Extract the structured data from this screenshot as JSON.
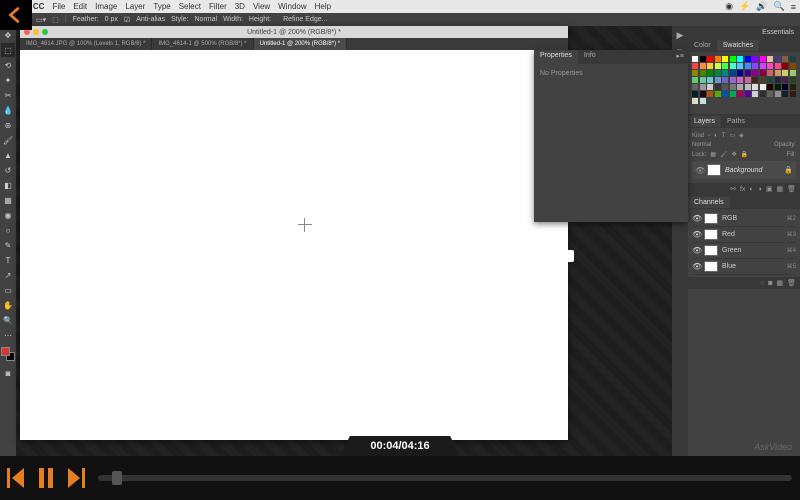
{
  "mac_menu": {
    "app": "toshop CC",
    "items": [
      "File",
      "Edit",
      "Image",
      "Layer",
      "Type",
      "Select",
      "Filter",
      "3D",
      "View",
      "Window",
      "Help"
    ]
  },
  "options": {
    "feather_label": "Feather:",
    "feather_value": "0 px",
    "antialias": "Anti-alias",
    "style_label": "Style:",
    "style_value": "Normal",
    "width_label": "Width:",
    "height_label": "Height:",
    "refine": "Refine Edge..."
  },
  "doc": {
    "title": "Untitled-1 @ 200% (RGB/8*) *",
    "tabs": [
      {
        "label": "IMG_4614.JPG @ 100% (Levels 1, RGB/8) *"
      },
      {
        "label": "IMG_4614-1 @ 500% (RGB/8*) *"
      },
      {
        "label": "Untitled-1 @ 200% (RGB/8*) *"
      }
    ]
  },
  "properties": {
    "tab1": "Properties",
    "tab2": "Info",
    "body": "No Properties"
  },
  "essentials": "Essentials",
  "color_panel": {
    "tab1": "Color",
    "tab2": "Swatches"
  },
  "swatch_colors": [
    "#fff",
    "#000",
    "#f00",
    "#ff8000",
    "#ff0",
    "#0f0",
    "#0ff",
    "#00f",
    "#80f",
    "#f0f",
    "#e0c0a0",
    "#404080",
    "#806040",
    "#204040",
    "#f44",
    "#f84",
    "#fc4",
    "#cf4",
    "#4f4",
    "#4fc",
    "#4cf",
    "#48f",
    "#84f",
    "#c4f",
    "#f4c",
    "#f48",
    "#800",
    "#840",
    "#880",
    "#480",
    "#080",
    "#084",
    "#088",
    "#048",
    "#008",
    "#408",
    "#808",
    "#804",
    "#c66",
    "#c96",
    "#cc6",
    "#9c6",
    "#6c6",
    "#6c9",
    "#6cc",
    "#69c",
    "#66c",
    "#96c",
    "#c6c",
    "#c69",
    "#422",
    "#442",
    "#244",
    "#224",
    "#424",
    "#242",
    "#666",
    "#999",
    "#ccc",
    "#333",
    "#555",
    "#777",
    "#aaa",
    "#bbb",
    "#ddd",
    "#eee",
    "#200",
    "#020",
    "#002",
    "#220",
    "#022",
    "#202",
    "#a50",
    "#5a0",
    "#05a",
    "#0a5",
    "#a05",
    "#50a",
    "#d0d0d0",
    "#303030",
    "#606060",
    "#909090",
    "#102030",
    "#302010",
    "#e0e0c0",
    "#c0e0e0"
  ],
  "layers": {
    "tab1": "Layers",
    "tab2": "Paths",
    "kind": "Kind",
    "mode": "Normal",
    "opacity_label": "Opacity:",
    "lock_label": "Lock:",
    "fill_label": "Fill:",
    "bg_name": "Background"
  },
  "channels": {
    "tab": "Channels",
    "rows": [
      {
        "name": "RGB",
        "key": "⌘2"
      },
      {
        "name": "Red",
        "key": "⌘3"
      },
      {
        "name": "Green",
        "key": "⌘4"
      },
      {
        "name": "Blue",
        "key": "⌘5"
      }
    ]
  },
  "video": {
    "timestamp": "00:04/04:16",
    "watermark": "AskVideo"
  }
}
